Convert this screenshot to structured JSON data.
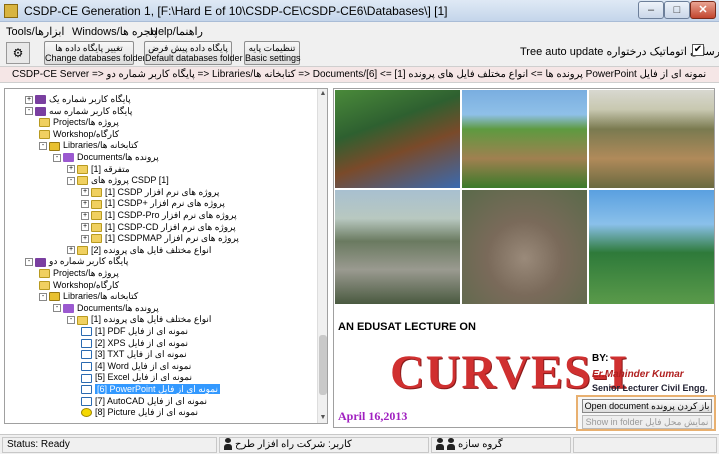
{
  "window": {
    "title": "CSDP-CE Generation 1, [F:\\Hard E of 10\\CSDP-CE\\CSDP-CE6\\Databases\\] [1]",
    "minimize": "–",
    "maximize": "□",
    "close": "✕"
  },
  "menu": {
    "tools": "Tools/ابزارها",
    "windows": "Windows/پنجره ها",
    "help": "Help/راهنما"
  },
  "toolbar": {
    "icon_label": "⚙",
    "change_folder_line1": "تغییر پایگاه داده ها",
    "change_folder_line2": "Change databases folder",
    "default_folder_line1": "پایگاه داده پیش فرض",
    "default_folder_line2": "Default databases folder",
    "basic_settings_line1": "تنظیمات پایه",
    "basic_settings_line2": "Basic settings",
    "tree_auto_update": "Tree auto update  بروزرسانی اتوماتیک درختواره",
    "tree_auto_update_checked": "✔"
  },
  "path": {
    "text": "CSDP-CE Server => پایگاه کاربر شماره دو => Libraries/کتابخانه ها => Documents/پرونده ها => انواع مختلف فایل های پرونده [1] => [6] PowerPoint نمونه ای از فایل"
  },
  "tree": {
    "rows": [
      {
        "label": "پایگاه کاربر شماره یک",
        "level": 1,
        "icon": "db",
        "exp": "+"
      },
      {
        "label": "پایگاه کاربر شماره سه",
        "level": 1,
        "icon": "db",
        "exp": "-"
      },
      {
        "label": "Projects/پروژه ها",
        "level": 2,
        "icon": "folder",
        "exp": ""
      },
      {
        "label": "Workshop/کارگاه",
        "level": 2,
        "icon": "folder",
        "exp": ""
      },
      {
        "label": "Libraries/کتابخانه ها",
        "level": 2,
        "icon": "lib",
        "exp": "-"
      },
      {
        "label": "Documents/پرونده ها",
        "level": 3,
        "icon": "doc",
        "exp": "-"
      },
      {
        "label": "متفرقه [1]",
        "level": 4,
        "icon": "folder",
        "exp": "+"
      },
      {
        "label": "پروژه های CSDP [1]",
        "level": 4,
        "icon": "folder",
        "exp": "-"
      },
      {
        "label": "[1] CSDP پروژه های نرم افزار",
        "level": 5,
        "icon": "folder",
        "exp": "+"
      },
      {
        "label": "[1] CSDP+ پروژه های نرم افزار",
        "level": 5,
        "icon": "folder",
        "exp": "+"
      },
      {
        "label": "[1] CSDP-Pro پروژه های نرم افزار",
        "level": 5,
        "icon": "folder",
        "exp": "+"
      },
      {
        "label": "[1] CSDP-CD پروژه های نرم افزار",
        "level": 5,
        "icon": "folder",
        "exp": "+"
      },
      {
        "label": "[1] CSDPMAP پروژه های نرم افزار",
        "level": 5,
        "icon": "folder",
        "exp": "+"
      },
      {
        "label": "انواع مختلف فایل های پرونده [2]",
        "level": 4,
        "icon": "folder",
        "exp": "+"
      },
      {
        "label": "پایگاه کاربر شماره دو",
        "level": 1,
        "icon": "db",
        "exp": "-"
      },
      {
        "label": "Projects/پروژه ها",
        "level": 2,
        "icon": "folder",
        "exp": ""
      },
      {
        "label": "Workshop/کارگاه",
        "level": 2,
        "icon": "folder",
        "exp": ""
      },
      {
        "label": "Libraries/کتابخانه ها",
        "level": 2,
        "icon": "lib",
        "exp": "-"
      },
      {
        "label": "Documents/پرونده ها",
        "level": 3,
        "icon": "doc",
        "exp": "-"
      },
      {
        "label": "انواع مختلف فایل های پرونده [1]",
        "level": 4,
        "icon": "folder",
        "exp": "-"
      },
      {
        "label": "[1] PDF نمونه ای از فایل",
        "level": 5,
        "icon": "file",
        "exp": ""
      },
      {
        "label": "[2] XPS نمونه ای از فایل",
        "level": 5,
        "icon": "file",
        "exp": ""
      },
      {
        "label": "[3] TXT نمونه ای از فایل",
        "level": 5,
        "icon": "file",
        "exp": ""
      },
      {
        "label": "[4] Word نمونه ای از فایل",
        "level": 5,
        "icon": "file",
        "exp": ""
      },
      {
        "label": "[5] Excel نمونه ای از فایل",
        "level": 5,
        "icon": "file",
        "exp": ""
      },
      {
        "label": "[6] PowerPoint نمونه ای از فایل",
        "level": 5,
        "icon": "file",
        "exp": "",
        "selected": true
      },
      {
        "label": "[7] AutoCAD نمونه ای از فایل",
        "level": 5,
        "icon": "file",
        "exp": ""
      },
      {
        "label": "[8] Picture نمونه ای از فایل",
        "level": 5,
        "icon": "smile",
        "exp": ""
      }
    ]
  },
  "preview": {
    "lecture": "AN EDUSAT LECTURE ON",
    "title": "CURVES-I",
    "by": "BY:",
    "author": "Er.Mahinder Kumar",
    "position": "Senior Lecturer Civil Engg.",
    "date": "April 16,2013"
  },
  "actions": {
    "open_document": "Open document  باز کردن پرونده",
    "show_in_folder": "Show in folder  نمایش محل فایل"
  },
  "status": {
    "ready": "Status: Ready",
    "user": "کاربر: شرکت راه افزار طرح",
    "group": "گروه سازه"
  }
}
